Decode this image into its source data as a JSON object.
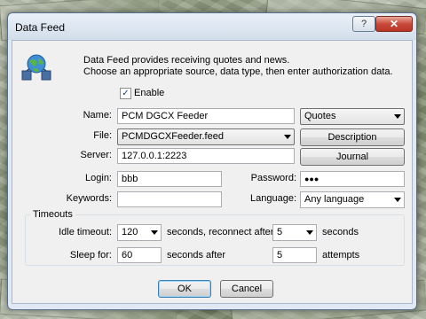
{
  "window": {
    "title": "Data Feed",
    "help_label": "?",
    "close_label": "✕"
  },
  "intro": {
    "line1": "Data Feed provides receiving quotes and news.",
    "line2": "Choose an appropriate source, data type, then enter authorization data."
  },
  "enable": {
    "label": "Enable",
    "checked": true,
    "check_glyph": "✓"
  },
  "form": {
    "name_label": "Name:",
    "name_value": "PCM DGCX Feeder",
    "type_value": "Quotes",
    "file_label": "File:",
    "file_value": "PCMDGCXFeeder.feed",
    "server_label": "Server:",
    "server_value": "127.0.0.1:2223",
    "login_label": "Login:",
    "login_value": "bbb",
    "password_label": "Password:",
    "password_value": "●●●",
    "keywords_label": "Keywords:",
    "keywords_value": "",
    "language_label": "Language:",
    "language_value": "Any language"
  },
  "buttons": {
    "description": "Description",
    "journal": "Journal",
    "ok": "OK",
    "cancel": "Cancel"
  },
  "timeouts": {
    "group_title": "Timeouts",
    "idle_label": "Idle timeout:",
    "idle_value": "120",
    "idle_mid": "seconds, reconnect after",
    "reconnect_value": "5",
    "idle_suffix": "seconds",
    "sleep_label": "Sleep for:",
    "sleep_value": "60",
    "sleep_mid": "seconds after",
    "attempts_value": "5",
    "attempts_suffix": "attempts"
  },
  "icons": {
    "app": "globe-network-icon",
    "help": "question-icon",
    "close": "close-icon",
    "dropdown": "chevron-down-icon"
  },
  "colors": {
    "window_frame": "#dfe8f3",
    "dialog_bg": "#f0f0f0",
    "close_button": "#c9493a",
    "default_button_border": "#3c7fb1"
  }
}
